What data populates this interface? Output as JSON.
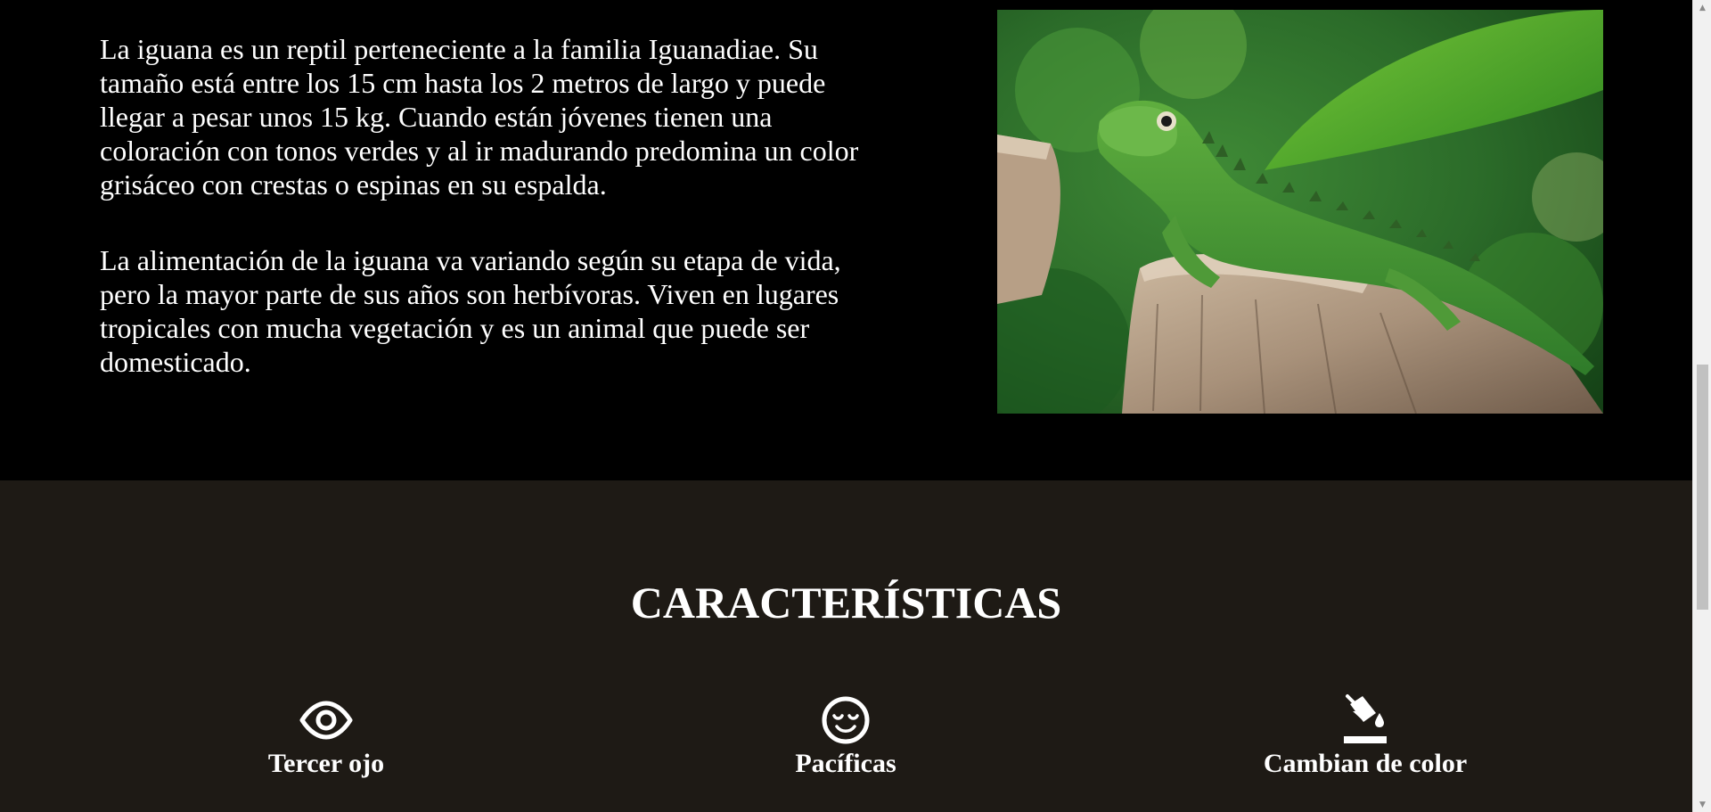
{
  "intro": {
    "paragraphs": [
      "La iguana es un reptil perteneciente a la familia Iguanadiae. Su tamaño está entre los 15 cm hasta los 2 metros de largo y puede llegar a pesar unos 15 kg. Cuando están jóvenes tienen una coloración con tonos verdes y al ir madurando predomina un color grisáceo con crestas o espinas en su espalda.",
      "La alimentación de la iguana va variando según su etapa de vida, pero la mayor parte de sus años son herbívoras. Viven en lugares tropicales con mucha vegetación y es un animal que puede ser domesticado."
    ],
    "photo_icon": "iguana-photo"
  },
  "features": {
    "title": "CARACTERÍSTICAS",
    "items": [
      {
        "label": "Tercer ojo",
        "icon": "eye-icon"
      },
      {
        "label": "Pacíficas",
        "icon": "relaxed-face-icon"
      },
      {
        "label": "Cambian de color",
        "icon": "paint-bucket-icon"
      }
    ]
  },
  "colors": {
    "intro_bg": "#000000",
    "features_bg": "#1e1a15",
    "text": "#ffffff"
  },
  "scrollbar": {
    "up_icon": "▲",
    "down_icon": "▼"
  }
}
